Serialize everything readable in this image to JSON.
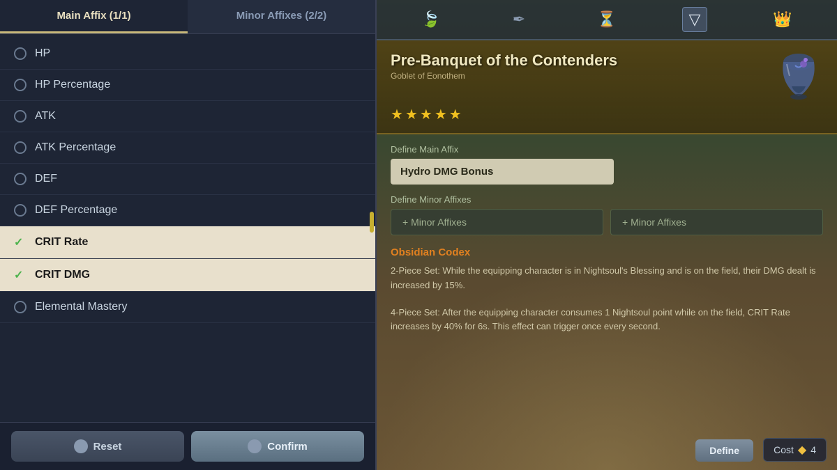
{
  "tabs": {
    "left_tab1": "Main Affix (1/1)",
    "left_tab2": "Minor Affixes (2/2)"
  },
  "affix_items": [
    {
      "id": "hp",
      "label": "HP",
      "selected": false,
      "checked": false
    },
    {
      "id": "hp_pct",
      "label": "HP Percentage",
      "selected": false,
      "checked": false
    },
    {
      "id": "atk",
      "label": "ATK",
      "selected": false,
      "checked": false
    },
    {
      "id": "atk_pct",
      "label": "ATK Percentage",
      "selected": false,
      "checked": false
    },
    {
      "id": "def",
      "label": "DEF",
      "selected": false,
      "checked": false
    },
    {
      "id": "def_pct",
      "label": "DEF Percentage",
      "selected": false,
      "checked": false
    },
    {
      "id": "crit_rate",
      "label": "CRIT Rate",
      "selected": true,
      "checked": true
    },
    {
      "id": "crit_dmg",
      "label": "CRIT DMG",
      "selected": true,
      "checked": true
    },
    {
      "id": "elemental_mastery",
      "label": "Elemental Mastery",
      "selected": false,
      "checked": false
    }
  ],
  "buttons": {
    "reset": "Reset",
    "confirm": "Confirm"
  },
  "right_panel": {
    "top_icons": [
      "🍃",
      "✒",
      "⏳",
      "▽",
      "👑"
    ],
    "active_icon_index": 3,
    "item_name": "Pre-Banquet of the Contenders",
    "item_subtitle": "Goblet of Eonothem",
    "stars": 5,
    "main_affix_label": "Define Main Affix",
    "main_affix_value": "Hydro DMG Bonus",
    "minor_affix_label": "Define Minor Affixes",
    "minor_affix_btn1": "+ Minor Affixes",
    "minor_affix_btn2": "+ Minor Affixes",
    "set_name": "Obsidian Codex",
    "set_desc_2piece": "2-Piece Set: While the equipping character is in Nightsoul's Blessing and is on the field, their DMG dealt is increased by 15%.",
    "set_desc_4piece": "4-Piece Set: After the equipping character consumes 1 Nightsoul point while on the field, CRIT Rate increases by 40% for 6s. This effect can trigger once every second.",
    "cost_label": "Cost",
    "cost_value": "4",
    "define_label": "Define"
  }
}
